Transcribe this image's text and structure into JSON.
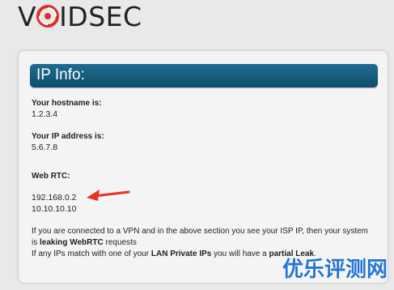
{
  "brand": {
    "logo_v": "V",
    "logo_rest": "IDSEC",
    "logo_alt": "VOIDSEC"
  },
  "panel": {
    "header": "IP Info:",
    "hostname_label": "Your hostname is:",
    "hostname_value": "1.2.3.4",
    "ip_label": "Your IP address is:",
    "ip_value": "5.6.7.8",
    "webrtc_label": "Web RTC:",
    "webrtc_ips": [
      "192.168.0.2",
      "10.10.10.10"
    ],
    "note_line1": "If you are connected to a VPN and in the above section you see your ISP IP, then your system",
    "note_line2_prefix": "is ",
    "note_line2_bold": "leaking WebRTC",
    "note_line2_suffix": " requests",
    "note_line3_prefix": "If any IPs match with one of your ",
    "note_line3_bold1": "LAN Private IPs",
    "note_line3_middle": " you will have a ",
    "note_line3_bold2": "partial Leak",
    "note_line3_suffix": "."
  },
  "annotation": {
    "arrow_color": "#e8322b"
  },
  "watermark": {
    "text": "优乐评测网",
    "color": "#1a6fd0"
  },
  "colors": {
    "header_bg": "#1a6488",
    "logo_red": "#d9302a"
  }
}
